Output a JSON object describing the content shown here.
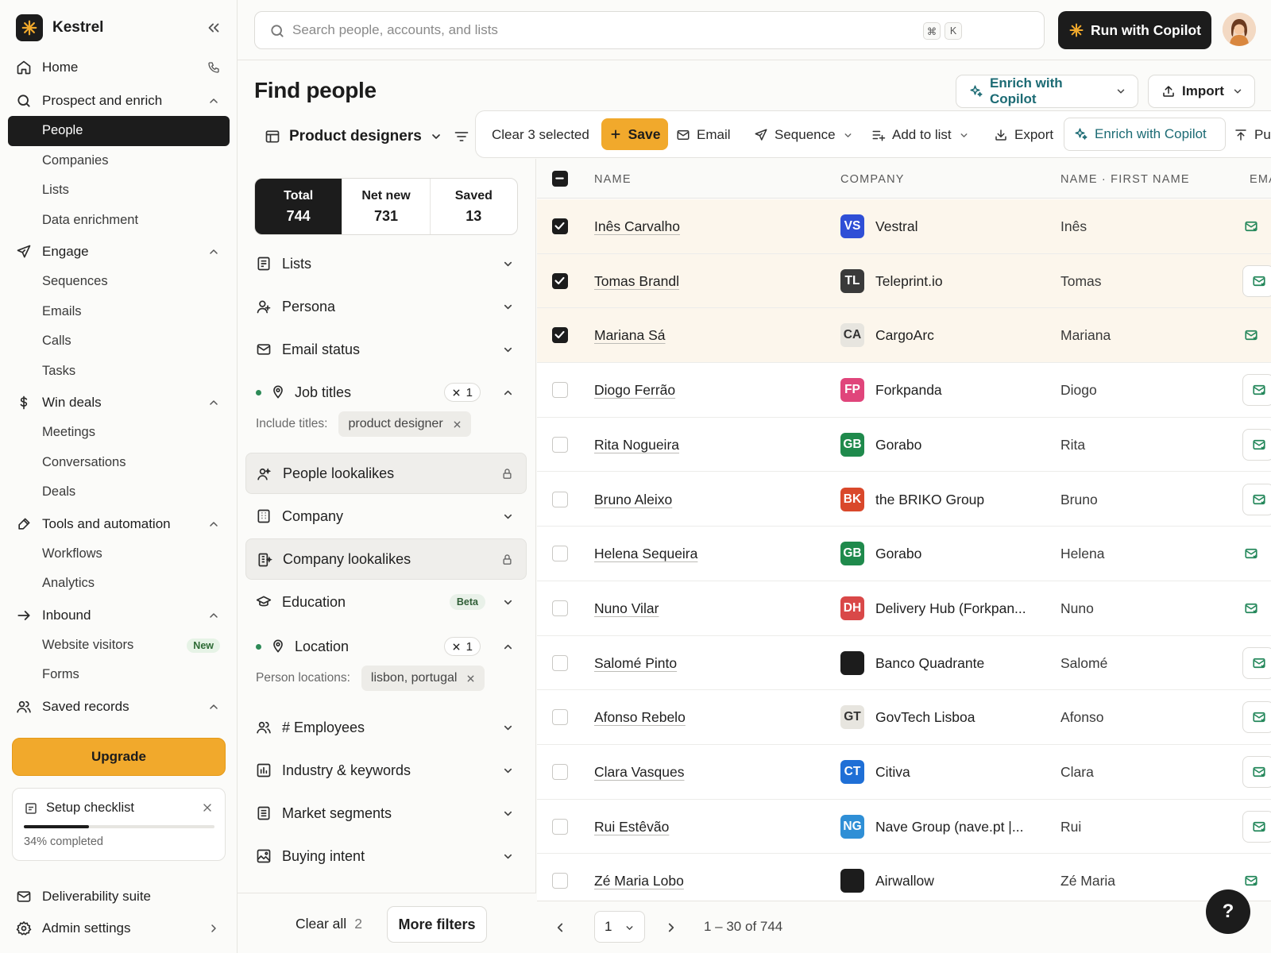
{
  "brand": {
    "name": "Kestrel"
  },
  "sidebar": {
    "items": [
      {
        "label": "Home",
        "icon": "home-icon"
      },
      {
        "label": "Prospect and enrich",
        "icon": "search-icon",
        "children": [
          "People",
          "Companies",
          "Lists",
          "Data enrichment"
        ]
      },
      {
        "label": "Engage",
        "icon": "send-icon",
        "children": [
          "Sequences",
          "Emails",
          "Calls",
          "Tasks"
        ]
      },
      {
        "label": "Win deals",
        "icon": "dollar-icon",
        "children": [
          "Meetings",
          "Conversations",
          "Deals"
        ]
      },
      {
        "label": "Tools and automation",
        "icon": "tools-icon",
        "children": [
          "Workflows",
          "Analytics"
        ]
      },
      {
        "label": "Inbound",
        "icon": "arrow-right-icon",
        "children": [
          "Website visitors",
          "Forms"
        ]
      },
      {
        "label": "Saved records",
        "icon": "users-icon"
      }
    ],
    "active": "People",
    "new_badge": "New",
    "upgrade_label": "Upgrade",
    "checklist": {
      "title": "Setup checklist",
      "progress": 34,
      "progress_label": "34% completed"
    },
    "bottom": [
      {
        "label": "Deliverability suite",
        "icon": "mail-icon"
      },
      {
        "label": "Admin settings",
        "icon": "gear-icon"
      }
    ]
  },
  "topbar": {
    "search_placeholder": "Search people, accounts, and lists",
    "kbd": [
      "⌘",
      "K"
    ],
    "run_label": "Run with Copilot"
  },
  "header": {
    "title": "Find people",
    "copilot_label": "Enrich with Copilot",
    "import_label": "Import",
    "list_name": "Product designers"
  },
  "actions": {
    "clear_label": "Clear 3 selected",
    "save_label": "Save",
    "email_label": "Email",
    "sequence_label": "Sequence",
    "add_list_label": "Add to list",
    "export_label": "Export",
    "copilot_label": "Enrich with Copilot",
    "push_label": "Pus"
  },
  "counts": [
    {
      "label": "Total",
      "value": "744"
    },
    {
      "label": "Net new",
      "value": "731"
    },
    {
      "label": "Saved",
      "value": "13"
    }
  ],
  "filters": {
    "lists": "Lists",
    "persona": "Persona",
    "email_status": "Email status",
    "job_titles": "Job titles",
    "job_titles_count": "1",
    "include_titles_label": "Include titles:",
    "include_titles_value": "product designer",
    "people_lookalikes": "People lookalikes",
    "company": "Company",
    "company_lookalikes": "Company lookalikes",
    "education": "Education",
    "beta": "Beta",
    "location": "Location",
    "location_count": "1",
    "person_locations_label": "Person locations:",
    "person_locations_value": "lisbon, portugal",
    "employees": "# Employees",
    "industry": "Industry & keywords",
    "market": "Market segments",
    "buying": "Buying intent",
    "clear_all": "Clear all",
    "clear_count": "2",
    "more_filters": "More filters"
  },
  "table": {
    "headers": {
      "name": "NAME",
      "company": "COMPANY",
      "first_name": "NAME · FIRST NAME",
      "email": "EMA"
    },
    "rows": [
      {
        "name": "Inês Carvalho",
        "logo": "VS",
        "logo_color": "#2f4fd6",
        "company": "Vestral",
        "first": "Inês",
        "selected": true,
        "boxed": false
      },
      {
        "name": "Tomas Brandl",
        "logo": "TL",
        "logo_color": "#3a3a3a",
        "company": "Teleprint.io",
        "first": "Tomas",
        "selected": true,
        "boxed": true
      },
      {
        "name": "Mariana Sá",
        "logo": "CA",
        "logo_color": "#e7e5df",
        "company": "CargoArc",
        "first": "Mariana",
        "selected": true,
        "boxed": false
      },
      {
        "name": "Diogo Ferrão",
        "logo": "FP",
        "logo_color": "#e0457b",
        "company": "Forkpanda",
        "first": "Diogo",
        "selected": false,
        "boxed": true
      },
      {
        "name": "Rita Nogueira",
        "logo": "GB",
        "logo_color": "#1f8a4c",
        "company": "Gorabo",
        "first": "Rita",
        "selected": false,
        "boxed": true
      },
      {
        "name": "Bruno Aleixo",
        "logo": "BK",
        "logo_color": "#d9482b",
        "company": "the BRIKO Group",
        "first": "Bruno",
        "selected": false,
        "boxed": true
      },
      {
        "name": "Helena Sequeira",
        "logo": "GB",
        "logo_color": "#1f8a4c",
        "company": "Gorabo",
        "first": "Helena",
        "selected": false,
        "boxed": false
      },
      {
        "name": "Nuno Vilar",
        "logo": "DH",
        "logo_color": "#d94848",
        "company": "Delivery Hub (Forkpan...",
        "first": "Nuno",
        "selected": false,
        "boxed": false
      },
      {
        "name": "Salomé Pinto",
        "logo": "",
        "logo_color": "#1c1c1c",
        "company": "Banco Quadrante",
        "first": "Salomé",
        "selected": false,
        "boxed": true
      },
      {
        "name": "Afonso Rebelo",
        "logo": "GT",
        "logo_color": "#e7e5df",
        "company": "GovTech Lisboa",
        "first": "Afonso",
        "selected": false,
        "boxed": true
      },
      {
        "name": "Clara Vasques",
        "logo": "CT",
        "logo_color": "#1f6fd6",
        "company": "Citiva",
        "first": "Clara",
        "selected": false,
        "boxed": true
      },
      {
        "name": "Rui Estêvão",
        "logo": "NG",
        "logo_color": "#2f8fd6",
        "company": "Nave Group (nave.pt |...",
        "first": "Rui",
        "selected": false,
        "boxed": true
      },
      {
        "name": "Zé Maria Lobo",
        "logo": "",
        "logo_color": "#1c1c1c",
        "company": "Airwallow",
        "first": "Zé Maria",
        "selected": false,
        "boxed": false
      }
    ]
  },
  "pagination": {
    "page": "1",
    "range": "1 – 30 of 744"
  },
  "help_label": "?"
}
